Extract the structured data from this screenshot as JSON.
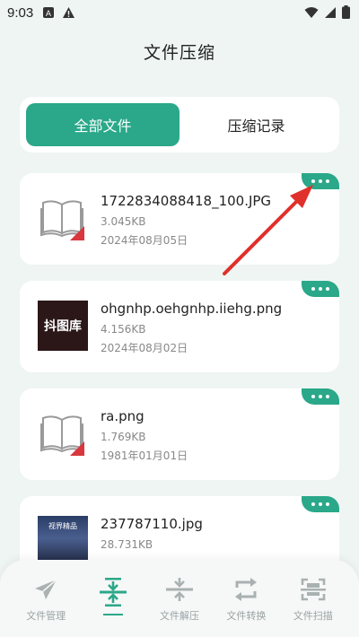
{
  "status": {
    "time": "9:03"
  },
  "title": "文件压缩",
  "tabs": [
    {
      "label": "全部文件",
      "active": true
    },
    {
      "label": "压缩记录",
      "active": false
    }
  ],
  "files": [
    {
      "name": "1722834088418_100.JPG",
      "size": "3.045KB",
      "date": "2024年08月05日",
      "thumb": "book-icon"
    },
    {
      "name": "ohgnhp.oehgnhp.iiehg.png",
      "size": "4.156KB",
      "date": "2024年08月02日",
      "thumb": "image-thumbnail",
      "thumb_text": "抖图库"
    },
    {
      "name": "ra.png",
      "size": "1.769KB",
      "date": "1981年01月01日",
      "thumb": "book-icon"
    },
    {
      "name": "237787110.jpg",
      "size": "28.731KB",
      "date": "",
      "thumb": "image-thumbnail",
      "thumb_text": "视界精品"
    }
  ],
  "nav": [
    {
      "label": "文件管理",
      "icon": "paper-plane-icon",
      "active": false
    },
    {
      "label": "",
      "icon": "compress-icon",
      "active": true
    },
    {
      "label": "文件解压",
      "icon": "decompress-icon",
      "active": false
    },
    {
      "label": "文件转换",
      "icon": "convert-icon",
      "active": false
    },
    {
      "label": "文件扫描",
      "icon": "scan-icon",
      "active": false
    }
  ],
  "colors": {
    "accent": "#2aa889",
    "background": "#eef5f3",
    "annotation": "#e0302b"
  }
}
